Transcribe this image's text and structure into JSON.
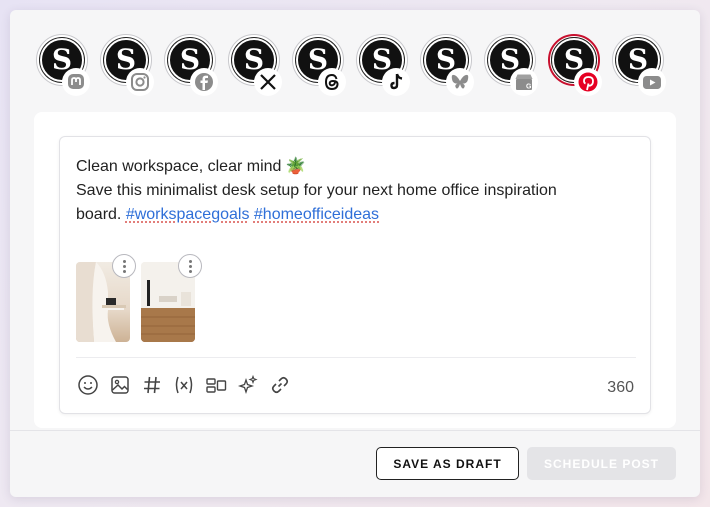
{
  "accounts": [
    {
      "avatar_letter": "S",
      "network": "mastodon-icon",
      "active": false
    },
    {
      "avatar_letter": "S",
      "network": "instagram-icon",
      "active": false
    },
    {
      "avatar_letter": "S",
      "network": "facebook-icon",
      "active": false
    },
    {
      "avatar_letter": "S",
      "network": "x-icon",
      "active": false
    },
    {
      "avatar_letter": "S",
      "network": "threads-icon",
      "active": false
    },
    {
      "avatar_letter": "S",
      "network": "tiktok-icon",
      "active": false
    },
    {
      "avatar_letter": "S",
      "network": "bluesky-icon",
      "active": false
    },
    {
      "avatar_letter": "S",
      "network": "google-business-icon",
      "active": false
    },
    {
      "avatar_letter": "S",
      "network": "pinterest-icon",
      "active": true
    },
    {
      "avatar_letter": "S",
      "network": "youtube-icon",
      "active": false
    }
  ],
  "post": {
    "line1": "Clean workspace, clear mind 🪴",
    "line2": "Save this minimalist desk setup for your next home office inspiration",
    "line3_prefix": "board. ",
    "hashtag1": "#workspacegoals",
    "hashtag2": "#homeofficeideas",
    "char_count": "360"
  },
  "media": [
    {
      "name": "media-thumbnail-1"
    },
    {
      "name": "media-thumbnail-2"
    }
  ],
  "toolbar": [
    "emoji-icon",
    "image-icon",
    "hashtag-icon",
    "variable-icon",
    "layout-icon",
    "ai-sparkle-icon",
    "link-icon"
  ],
  "footer": {
    "draft_label": "SAVE AS DRAFT",
    "schedule_label": "SCHEDULE POST"
  },
  "colors": {
    "hashtag": "#2f6fd8",
    "pinterest": "#e60023",
    "schedule_disabled": "#e4e4e7"
  }
}
